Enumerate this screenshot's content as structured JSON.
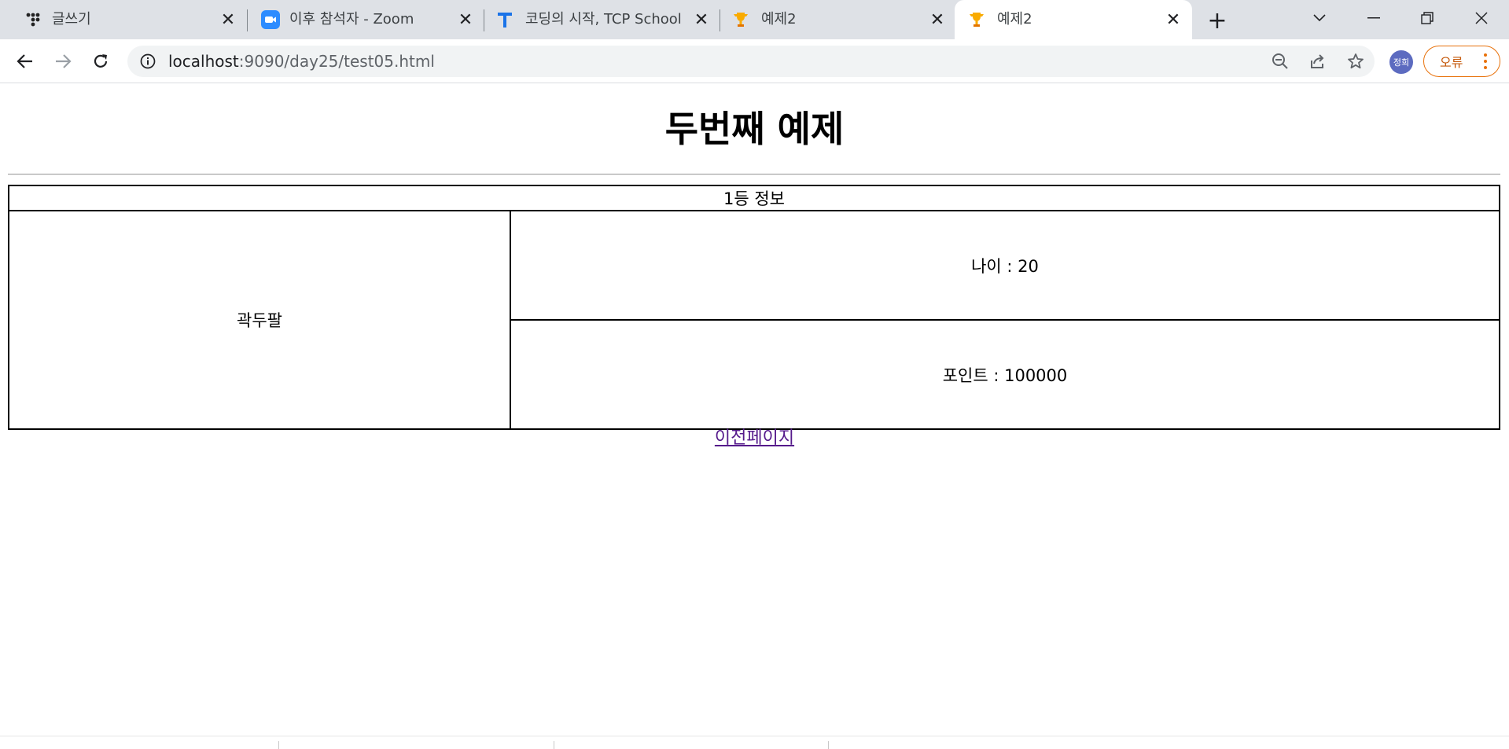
{
  "browser": {
    "tabs": [
      {
        "title": "글쓰기",
        "icon": "tistory-icon"
      },
      {
        "title": "이후 참석자 - Zoom",
        "icon": "zoom-icon"
      },
      {
        "title": "코딩의 시작, TCP School",
        "icon": "tcpschool-icon"
      },
      {
        "title": "예제2",
        "icon": "trophy-icon"
      },
      {
        "title": "예제2",
        "icon": "trophy-icon",
        "active": true
      }
    ],
    "url_host": "localhost",
    "url_rest": ":9090/day25/test05.html",
    "profile_label": "정희",
    "error_button_label": "오류",
    "accent_error_color": "#e8710a"
  },
  "page": {
    "heading": "두번째 예제",
    "table": {
      "header": "1등 정보",
      "name": "곽두팔",
      "age_text": "나이 : 20",
      "points_text": "포인트 : 100000"
    },
    "prev_link": "이전페이지"
  }
}
